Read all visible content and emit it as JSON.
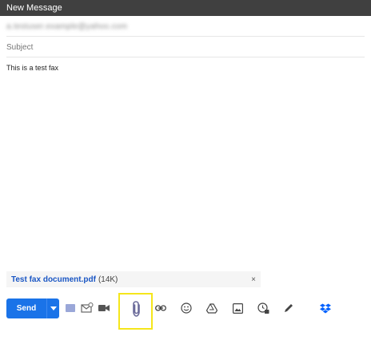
{
  "window": {
    "title": "New Message"
  },
  "compose": {
    "to_value": "a.testuser.example@yahoo.com",
    "subject_placeholder": "Subject",
    "body": "This is a test fax"
  },
  "attachment": {
    "filename": "Test fax document.pdf",
    "size": "(14K)",
    "remove_label": "×"
  },
  "toolbar": {
    "send_label": "Send",
    "icons": [
      "formatting-icon",
      "confidential-mode-icon",
      "video-icon",
      "attach-file-icon",
      "insert-link-icon",
      "emoji-icon",
      "google-drive-icon",
      "insert-photo-icon",
      "schedule-icon",
      "signature-icon",
      "dropbox-icon"
    ]
  },
  "colors": {
    "titlebar": "#404040",
    "send_button": "#1a73e8",
    "attachment_link": "#1a56c4",
    "highlight": "#f5e61b",
    "dropbox": "#0061ff"
  }
}
